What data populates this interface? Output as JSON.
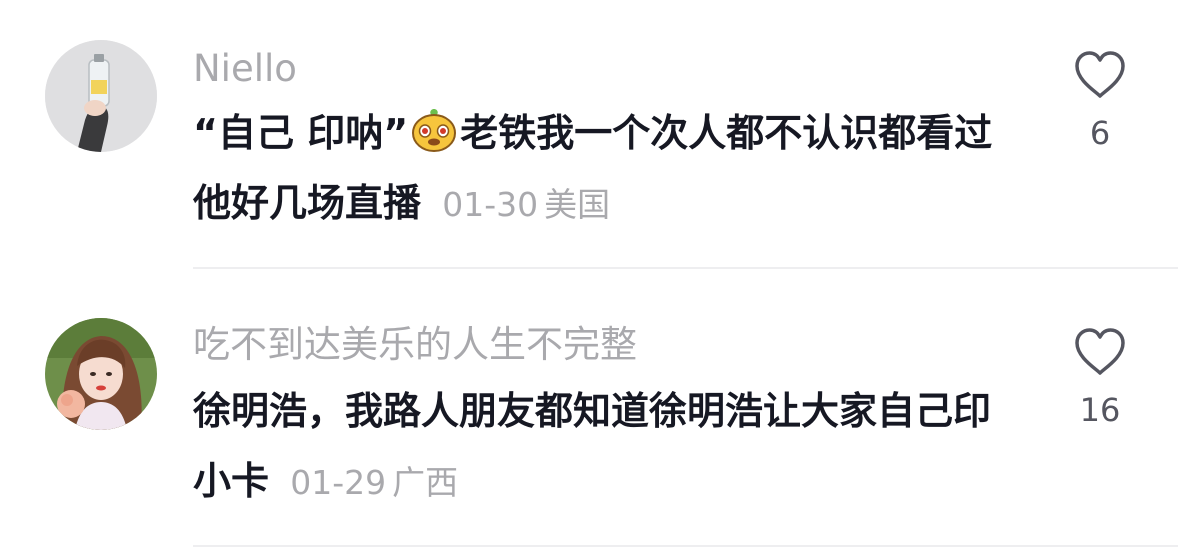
{
  "comments": [
    {
      "username": "Niello",
      "text_before_emoji": "“自己 印呐”",
      "text_after_emoji": "老铁我一个次人都不认识都看过他好几场直播",
      "date": "01-30",
      "location": "美国",
      "likes": "6",
      "emoji_icon": "yellow-face-emoji-icon"
    },
    {
      "username": "吃不到达美乐的人生不完整",
      "text": "徐明浩，我路人朋友都知道徐明浩让大家自己印小卡",
      "date": "01-29",
      "location": "广西",
      "likes": "16"
    }
  ]
}
